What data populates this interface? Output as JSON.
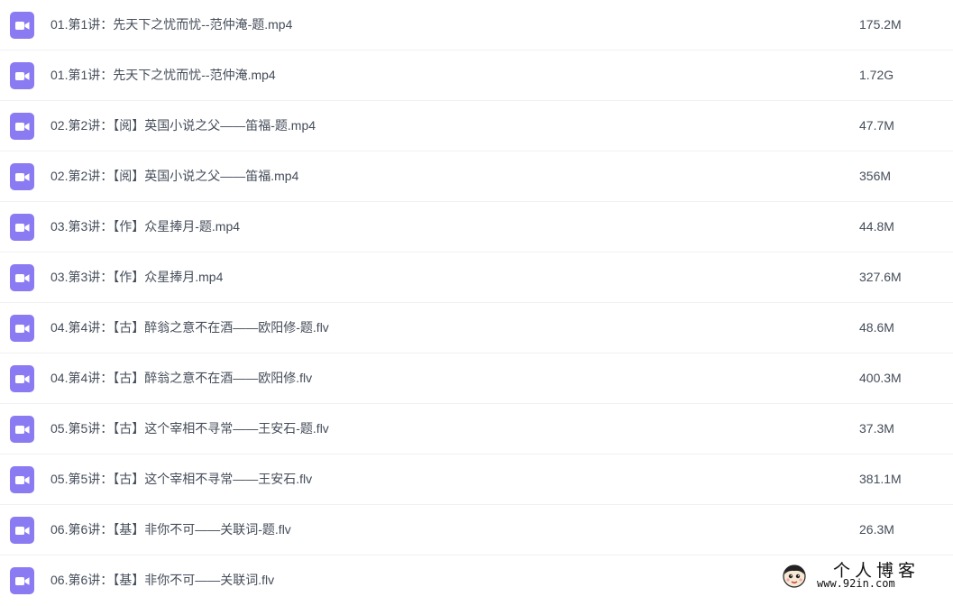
{
  "files": [
    {
      "name": "01.第1讲：先天下之忧而忧--范仲淹-题.mp4",
      "size": "175.2M",
      "icon": "video-file-icon"
    },
    {
      "name": "01.第1讲：先天下之忧而忧--范仲淹.mp4",
      "size": "1.72G",
      "icon": "video-file-icon"
    },
    {
      "name": "02.第2讲：【阅】英国小说之父——笛福-题.mp4",
      "size": "47.7M",
      "icon": "video-file-icon"
    },
    {
      "name": "02.第2讲：【阅】英国小说之父——笛福.mp4",
      "size": "356M",
      "icon": "video-file-icon"
    },
    {
      "name": "03.第3讲：【作】众星捧月-题.mp4",
      "size": "44.8M",
      "icon": "video-file-icon"
    },
    {
      "name": "03.第3讲：【作】众星捧月.mp4",
      "size": "327.6M",
      "icon": "video-file-icon"
    },
    {
      "name": "04.第4讲：【古】醉翁之意不在酒——欧阳修-题.flv",
      "size": "48.6M",
      "icon": "video-file-icon"
    },
    {
      "name": "04.第4讲：【古】醉翁之意不在酒——欧阳修.flv",
      "size": "400.3M",
      "icon": "video-file-icon"
    },
    {
      "name": "05.第5讲：【古】这个宰相不寻常——王安石-题.flv",
      "size": "37.3M",
      "icon": "video-file-icon"
    },
    {
      "name": "05.第5讲：【古】这个宰相不寻常——王安石.flv",
      "size": "381.1M",
      "icon": "video-file-icon"
    },
    {
      "name": "06.第6讲：【基】非你不可——关联词-题.flv",
      "size": "26.3M",
      "icon": "video-file-icon"
    },
    {
      "name": "06.第6讲：【基】非你不可——关联词.flv",
      "size": "",
      "icon": "video-file-icon"
    }
  ],
  "colors": {
    "icon_purple": "#8b7bf3",
    "text": "#454d5a",
    "divider": "#f0f0f2"
  },
  "watermark": {
    "title": "个人博客",
    "url": "www.92in.com"
  }
}
